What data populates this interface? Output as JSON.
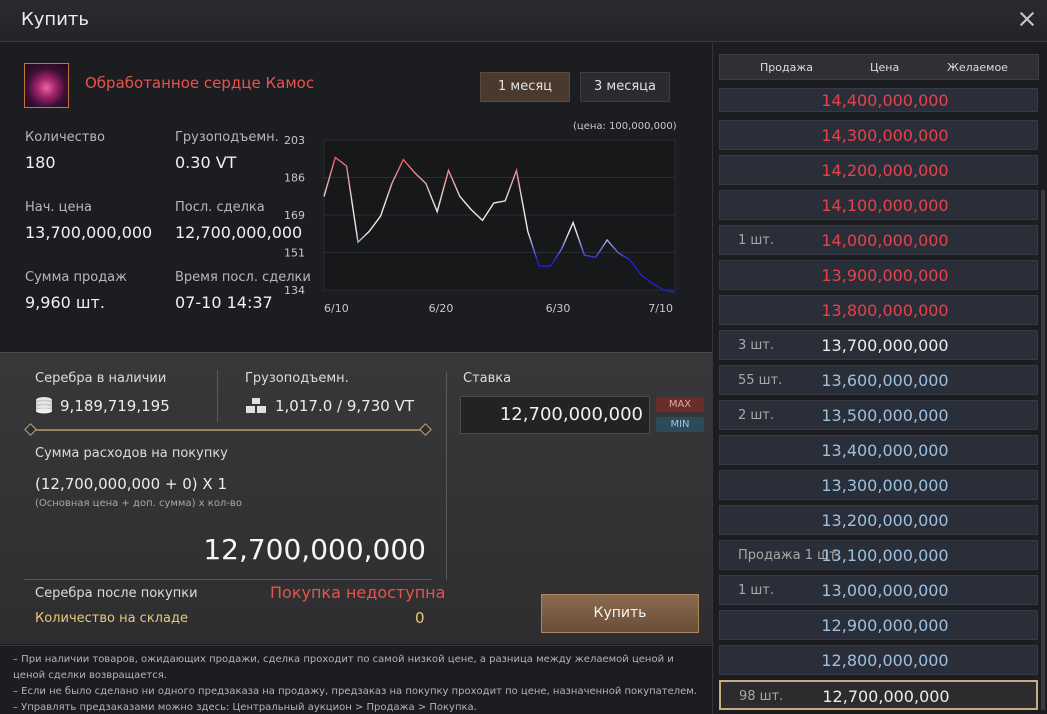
{
  "window": {
    "title": "Купить"
  },
  "item": {
    "name": "Обработанное сердце Камос",
    "icon": "kamos-heart-icon"
  },
  "periods": [
    "1 месяц",
    "3 месяца"
  ],
  "stats": {
    "quantity_label": "Количество",
    "quantity": "180",
    "weight_label": "Грузоподъемн.",
    "weight": "0.30 VT",
    "start_price_label": "Нач. цена",
    "start_price": "13,700,000,000",
    "last_deal_label": "Посл. сделка",
    "last_deal": "12,700,000,000",
    "sales_total_label": "Сумма продаж",
    "sales_total": "9,960 шт.",
    "last_deal_time_label": "Время посл. сделки",
    "last_deal_time": "07-10 14:37"
  },
  "chart_data": {
    "type": "line",
    "note": "(цена: 100,000,000)",
    "y_ticks": [
      "203",
      "186",
      "169",
      "151",
      "134"
    ],
    "x_ticks": [
      "6/10",
      "6/20",
      "6/30",
      "7/10"
    ],
    "ylim": [
      134,
      203
    ],
    "x": [
      1,
      2,
      3,
      4,
      5,
      6,
      7,
      8,
      9,
      10,
      11,
      12,
      13,
      14,
      15,
      16,
      17,
      18,
      19,
      20,
      21,
      22,
      23,
      24,
      25,
      26,
      27,
      28,
      29,
      30,
      31,
      32
    ],
    "values": [
      177,
      195,
      191,
      156,
      161,
      168,
      183,
      194,
      188,
      183,
      170,
      189,
      177,
      171,
      166,
      174,
      175,
      189,
      161,
      145,
      145,
      153,
      165,
      150,
      149,
      157,
      151,
      148,
      141,
      137,
      134,
      133
    ],
    "colors": {
      "high": "#e8232c",
      "mid": "#e8e8e8",
      "low": "#2020d8"
    }
  },
  "purchase": {
    "silver_label": "Серебра в наличии",
    "silver": "9,189,719,195",
    "weight_label": "Грузоподъемн.",
    "weight": "1,017.0 / 9,730 VT",
    "cost_label": "Сумма расходов на покупку",
    "formula": "(12,700,000,000 + 0) X 1",
    "formula_hint": "(Основная цена + доп. сумма) x кол-во",
    "total": "12,700,000,000",
    "silver_after_label": "Серебра после покупки",
    "unavailable": "Покупка недоступна",
    "storage_label": "Количество на складе",
    "storage": "0",
    "bid_label": "Ставка",
    "bid_value": "12,700,000,000",
    "max_label": "MAX",
    "min_label": "MIN",
    "buy_label": "Купить"
  },
  "notes": [
    "– При наличии товаров, ожидающих продажи, сделка проходит по самой низкой цене, а разница между желаемой ценой и",
    "ценой сделки возвращается.",
    "– Если не было сделано ни одного предзаказа на продажу, предзаказ на покупку проходит по цене, назначенной покупателем.",
    "– Управлять предзаказами можно здесь: Центральный аукцион > Продажа > Покупка."
  ],
  "price_list": {
    "headers": [
      "Продажа",
      "Цена",
      "Желаемое"
    ],
    "rows": [
      {
        "qty": "",
        "price": "14,400,000,000",
        "kind": "sell"
      },
      {
        "qty": "",
        "price": "14,300,000,000",
        "kind": "sell"
      },
      {
        "qty": "",
        "price": "14,200,000,000",
        "kind": "sell"
      },
      {
        "qty": "",
        "price": "14,100,000,000",
        "kind": "sell"
      },
      {
        "qty": "1 шт.",
        "price": "14,000,000,000",
        "kind": "sell"
      },
      {
        "qty": "",
        "price": "13,900,000,000",
        "kind": "sell"
      },
      {
        "qty": "",
        "price": "13,800,000,000",
        "kind": "sell"
      },
      {
        "qty": "3 шт.",
        "price": "13,700,000,000",
        "kind": "base"
      },
      {
        "qty": "55 шт.",
        "price": "13,600,000,000",
        "kind": "buy"
      },
      {
        "qty": "2 шт.",
        "price": "13,500,000,000",
        "kind": "buy"
      },
      {
        "qty": "",
        "price": "13,400,000,000",
        "kind": "buy"
      },
      {
        "qty": "",
        "price": "13,300,000,000",
        "kind": "buy"
      },
      {
        "qty": "",
        "price": "13,200,000,000",
        "kind": "buy"
      },
      {
        "qty": "Продажа 1 шт.",
        "price": "13,100,000,000",
        "kind": "buy"
      },
      {
        "qty": "1 шт.",
        "price": "13,000,000,000",
        "kind": "buy"
      },
      {
        "qty": "",
        "price": "12,900,000,000",
        "kind": "buy"
      },
      {
        "qty": "",
        "price": "12,800,000,000",
        "kind": "buy"
      },
      {
        "qty": "98 шт.",
        "price": "12,700,000,000",
        "kind": "selected"
      }
    ],
    "colors": {
      "sell": "#e8414b",
      "base": "#ececec",
      "buy": "#9cc0e0"
    }
  }
}
